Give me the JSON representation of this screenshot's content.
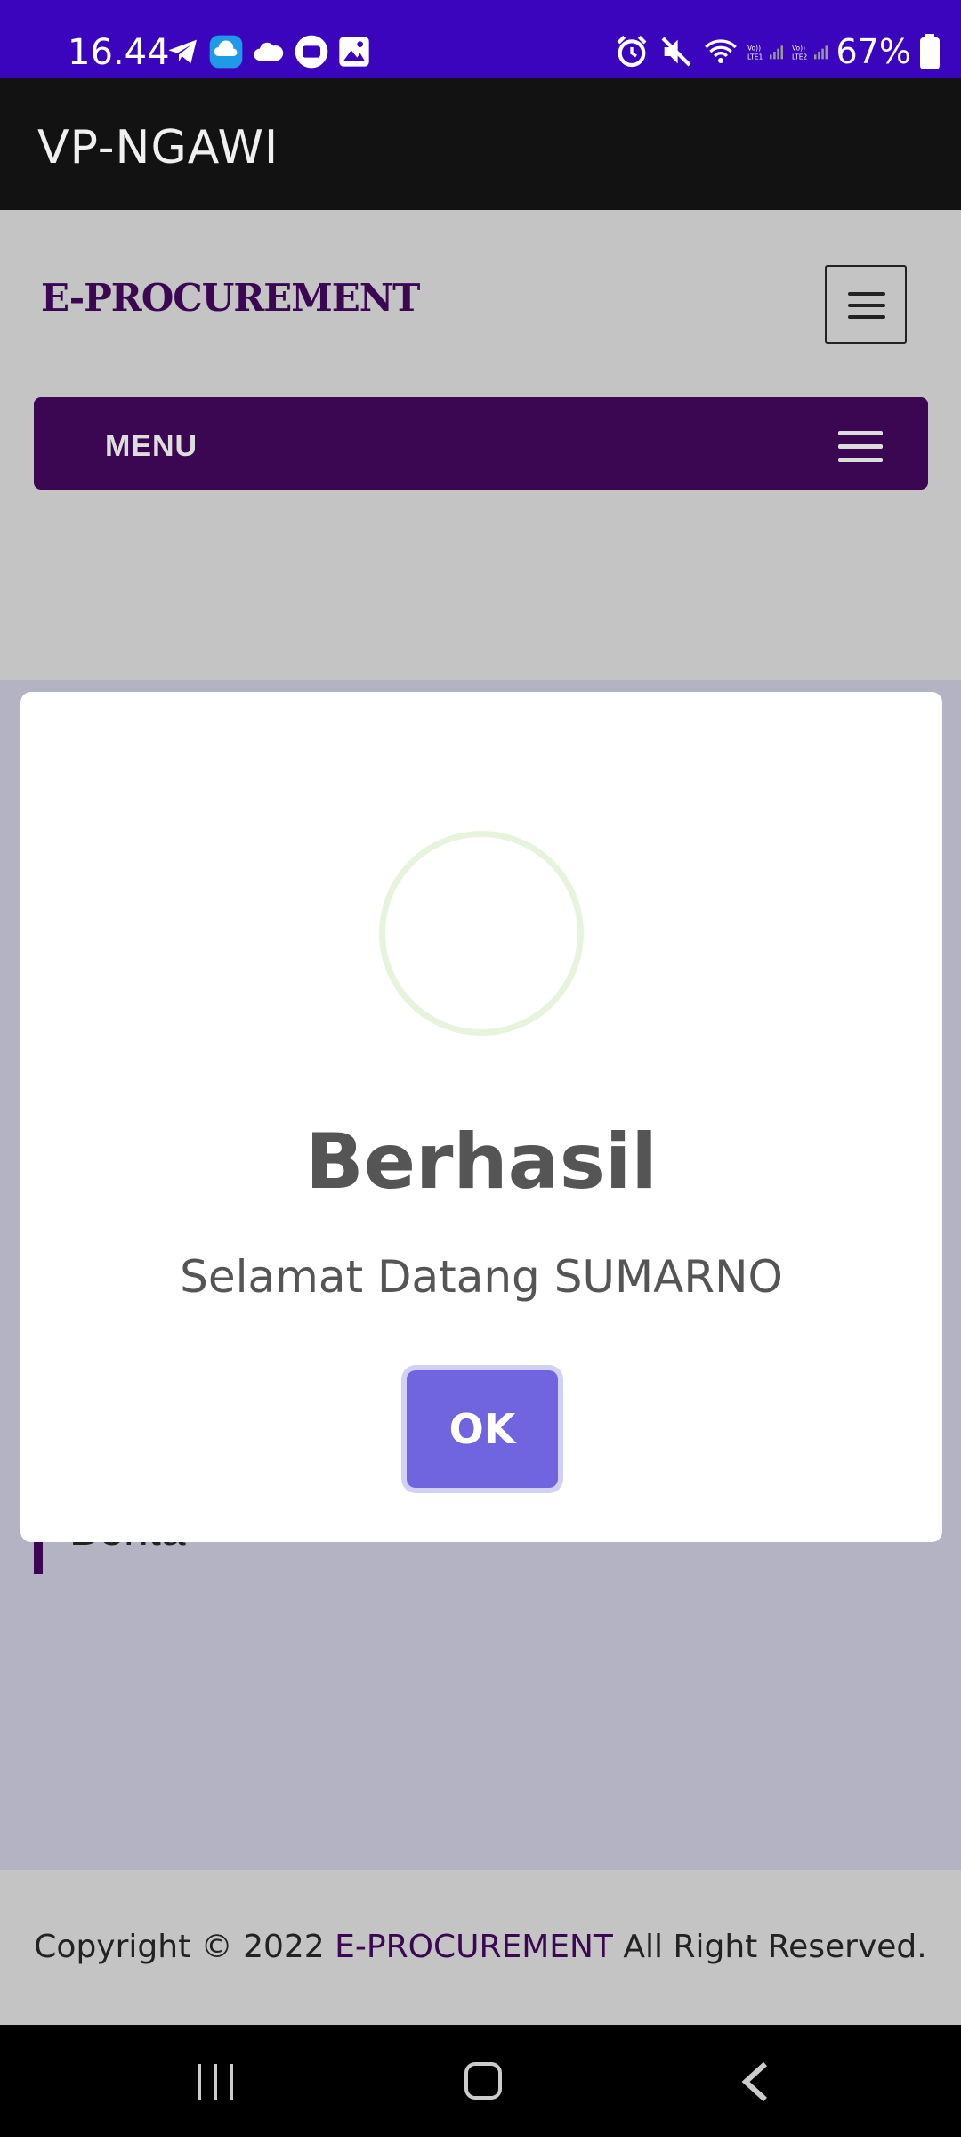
{
  "status_bar": {
    "time": "16.44",
    "battery": "67%",
    "left_icons": [
      "telegram-icon",
      "cloud-upload-icon",
      "weather-icon",
      "chat-icon",
      "gallery-icon"
    ],
    "right_icons": [
      "alarm-icon",
      "mute-icon",
      "wifi-icon",
      "signal-lte1-icon",
      "signal-lte2-icon",
      "battery-icon"
    ],
    "color": "#3a05bd"
  },
  "app_bar": {
    "title": "VP-NGAWI"
  },
  "site_header": {
    "brand": "E-PROCUREMENT",
    "menu_label": "MENU",
    "brand_color": "#3b0752"
  },
  "content": {
    "section_heading": "Berita"
  },
  "dialog": {
    "title": "Berhasil",
    "message": "Selamat Datang SUMARNO",
    "ok_label": "OK",
    "button_color": "#7065de"
  },
  "footer": {
    "prefix": "Copyright © 2022 ",
    "brand": "E-PROCUREMENT",
    "suffix": " All Right Reserved."
  }
}
